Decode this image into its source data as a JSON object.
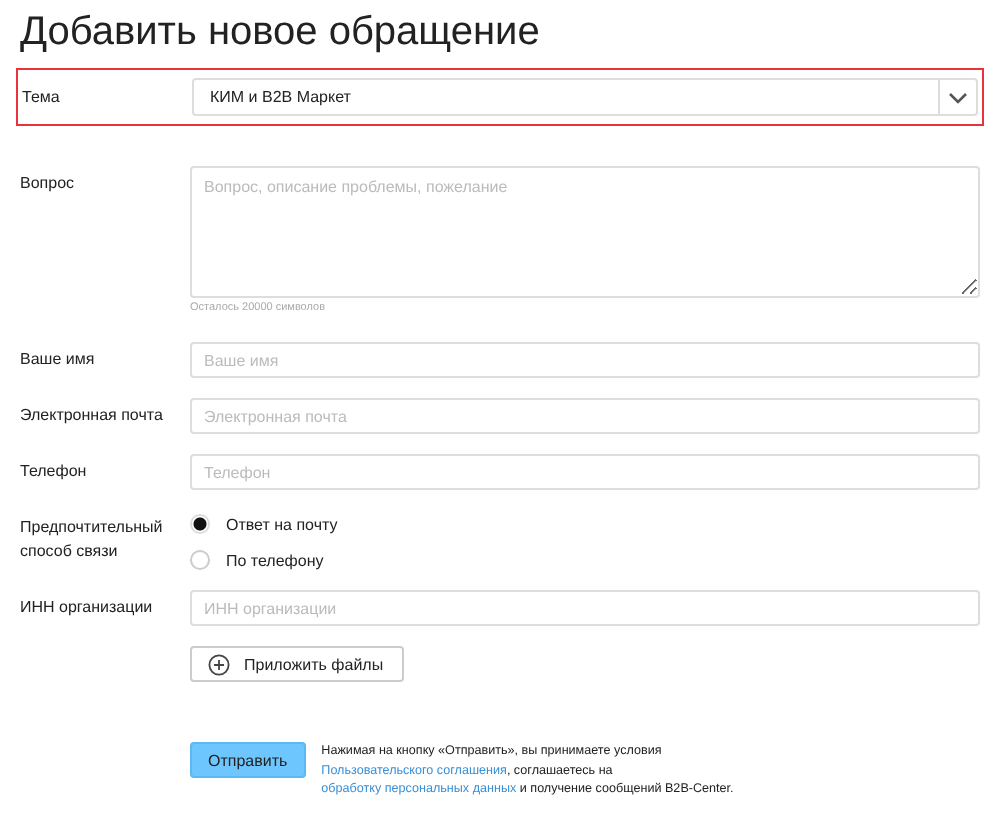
{
  "title": "Добавить новое обращение",
  "topic": {
    "label": "Тема",
    "value": "КИМ и B2B Маркет",
    "highlighted": true
  },
  "question": {
    "label": "Вопрос",
    "placeholder": "Вопрос, описание проблемы, пожелание",
    "counter": "Осталось 20000 символов"
  },
  "fields": [
    {
      "label": "Ваше имя",
      "placeholder": "Ваше имя"
    },
    {
      "label": "Электронная почта",
      "placeholder": "Электронная почта"
    },
    {
      "label": "Телефон",
      "placeholder": "Телефон"
    }
  ],
  "contact": {
    "label": "Предпочтительный способ связи",
    "options": [
      {
        "label": "Ответ на почту",
        "selected": true
      },
      {
        "label": "По телефону",
        "selected": false
      }
    ]
  },
  "inn": {
    "label": "ИНН организации",
    "placeholder": "ИНН организации"
  },
  "attach_button": "Приложить файлы",
  "submit_button": "Отправить",
  "note": [
    {
      "kind": "text",
      "text": "Нажимая на кнопку «Отправить», вы принимаете условия "
    },
    {
      "kind": "link",
      "text": "Пользовательского соглашения"
    },
    {
      "kind": "text",
      "text": ", соглашаетесь на "
    },
    {
      "kind": "link",
      "text": "обработку персональных данных"
    },
    {
      "kind": "text",
      "text": " и получение сообщений B2B-Center."
    }
  ]
}
